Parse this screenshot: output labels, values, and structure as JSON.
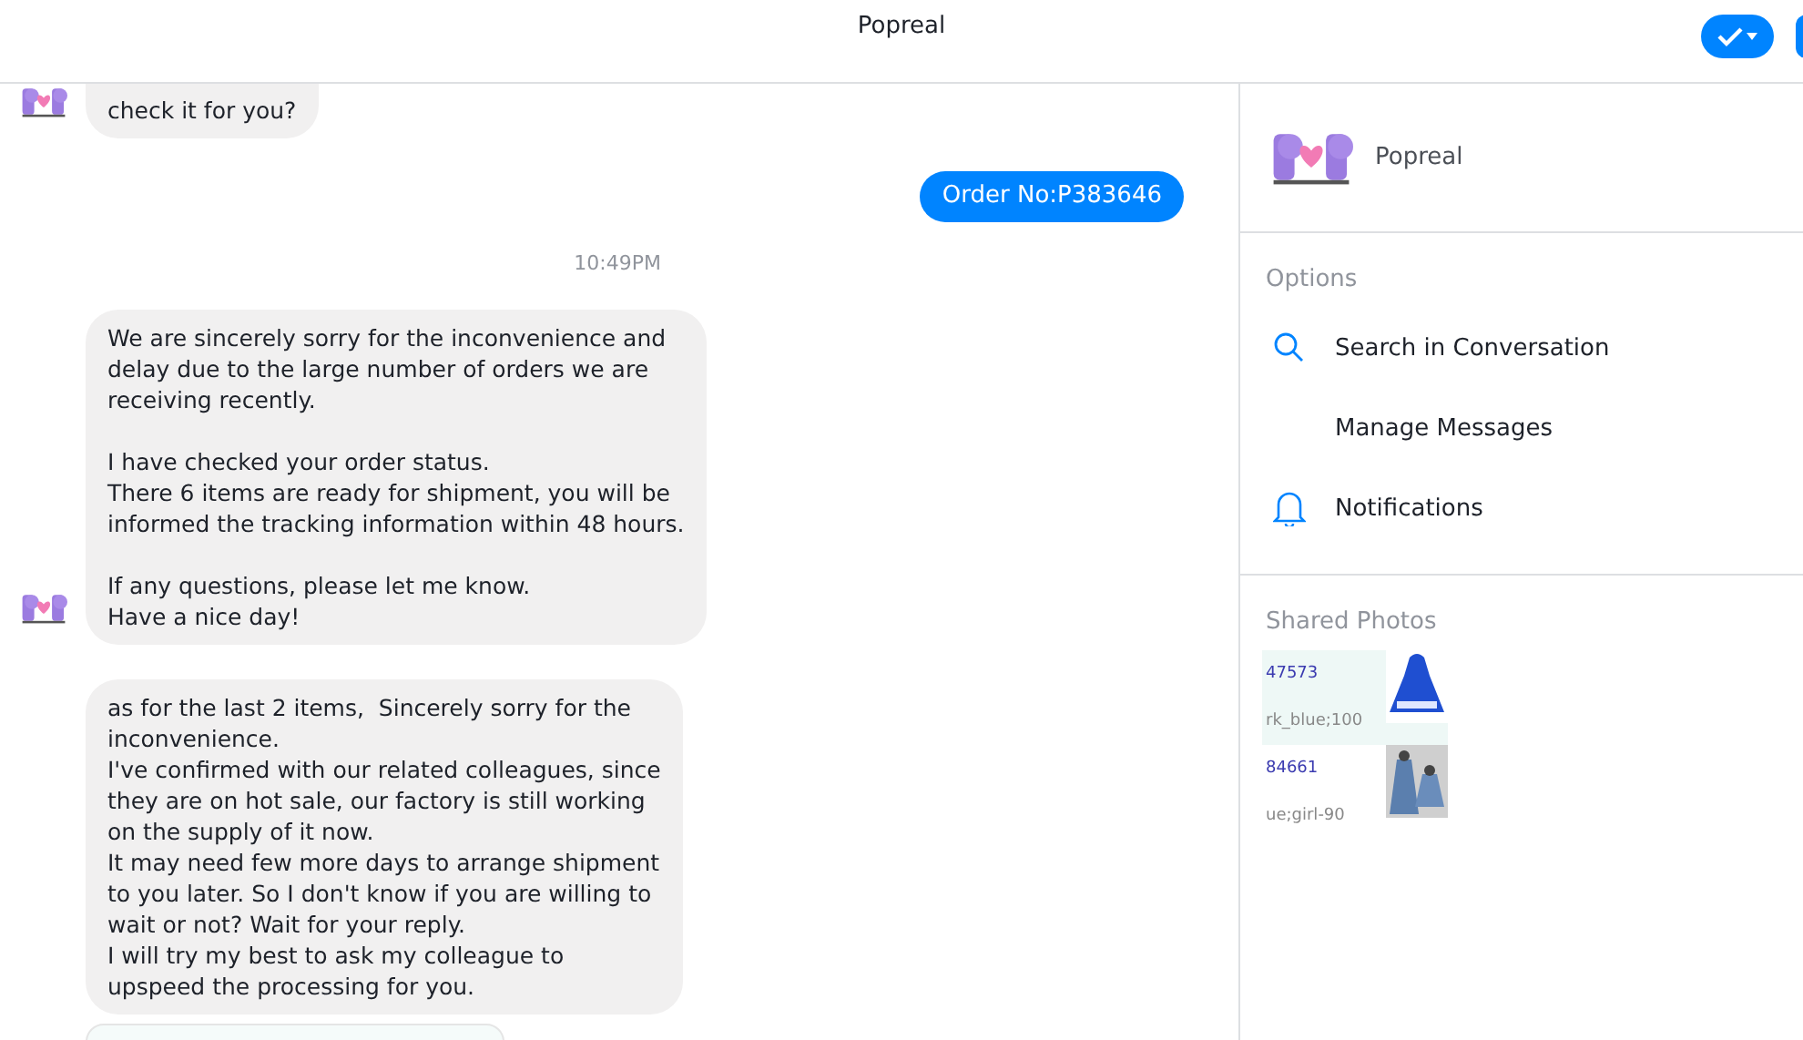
{
  "header": {
    "title": "Popreal"
  },
  "messages": [
    {
      "kind": "incoming",
      "avatar": true,
      "text": "check it for you?"
    },
    {
      "kind": "outgoing",
      "text": "Order No:P383646"
    },
    {
      "kind": "time",
      "text": "10:49PM"
    },
    {
      "kind": "incoming",
      "avatar": true,
      "text": "We are sincerely sorry for the inconvenience and\ndelay due to the large number of orders we are\nreceiving recently.\n\nI have checked your order status.\nThere 6 items are ready for shipment, you will be\ninformed the tracking information within 48 hours.\n\nIf any questions, please let me know.\nHave a nice day!"
    },
    {
      "kind": "incoming",
      "avatar": false,
      "text": "as for the last 2 items,  Sincerely sorry for the\ninconvenience.\nI've confirmed with our related colleagues, since\nthey are on hot sale, our factory is still working\non the supply of it now.\nIt may need few more days to arrange shipment\nto you later. So I don't know if you are willing to\nwait or not? Wait for your reply.\nI will try my best to ask my colleague to\nupspeed the processing for you."
    },
    {
      "kind": "attachment"
    }
  ],
  "sidebar": {
    "name": "Popreal",
    "options_label": "Options",
    "options": [
      {
        "kind": "search",
        "label": "Search in Conversation"
      },
      {
        "kind": "plain",
        "label": "Manage Messages"
      },
      {
        "kind": "bell",
        "label": "Notifications"
      }
    ],
    "photos_label": "Shared Photos",
    "photos": [
      {
        "code": "47573",
        "detail": "rk_blue;100",
        "highlighted": true
      },
      {
        "code": "84661",
        "detail": "ue;girl-90",
        "highlighted": false
      }
    ]
  }
}
